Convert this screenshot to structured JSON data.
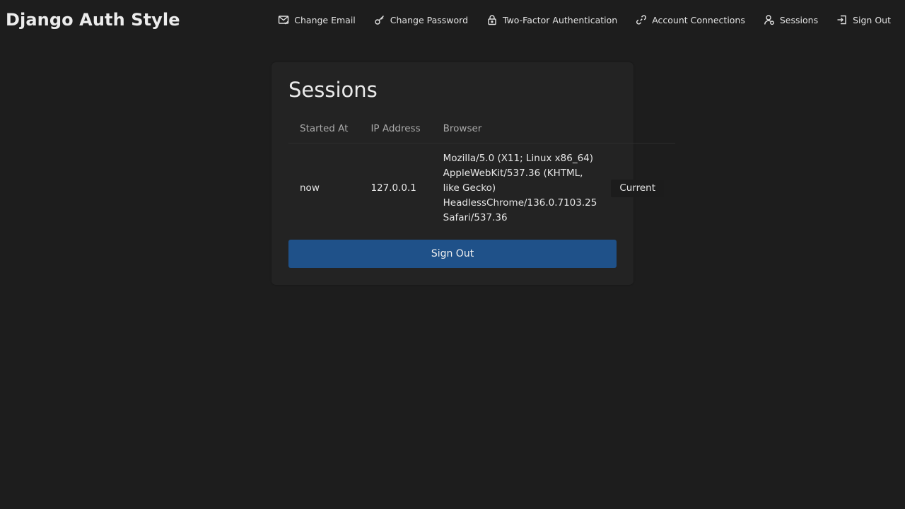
{
  "brand": {
    "title": "Django Auth Style"
  },
  "nav": {
    "items": [
      {
        "label": "Change Email",
        "icon": "envelope-check-icon"
      },
      {
        "label": "Change Password",
        "icon": "key-icon"
      },
      {
        "label": "Two-Factor Authentication",
        "icon": "lock-icon"
      },
      {
        "label": "Account Connections",
        "icon": "link-icon"
      },
      {
        "label": "Sessions",
        "icon": "user-icon"
      },
      {
        "label": "Sign Out",
        "icon": "sign-out-icon"
      }
    ]
  },
  "card": {
    "title": "Sessions",
    "table": {
      "headers": [
        "Started At",
        "IP Address",
        "Browser"
      ],
      "rows": [
        {
          "started_at": "now",
          "ip_address": "127.0.0.1",
          "browser": "Mozilla/5.0 (X11; Linux x86_64) AppleWebKit/537.36 (KHTML, like Gecko) HeadlessChrome/136.0.7103.25 Safari/537.36",
          "status": "Current"
        }
      ]
    },
    "sign_out_label": "Sign Out"
  },
  "colors": {
    "background": "#1d1d1d",
    "card": "#232323",
    "primary_button": "#1f5189",
    "text": "#e6e6e6",
    "muted_text": "#a9a9a9"
  }
}
